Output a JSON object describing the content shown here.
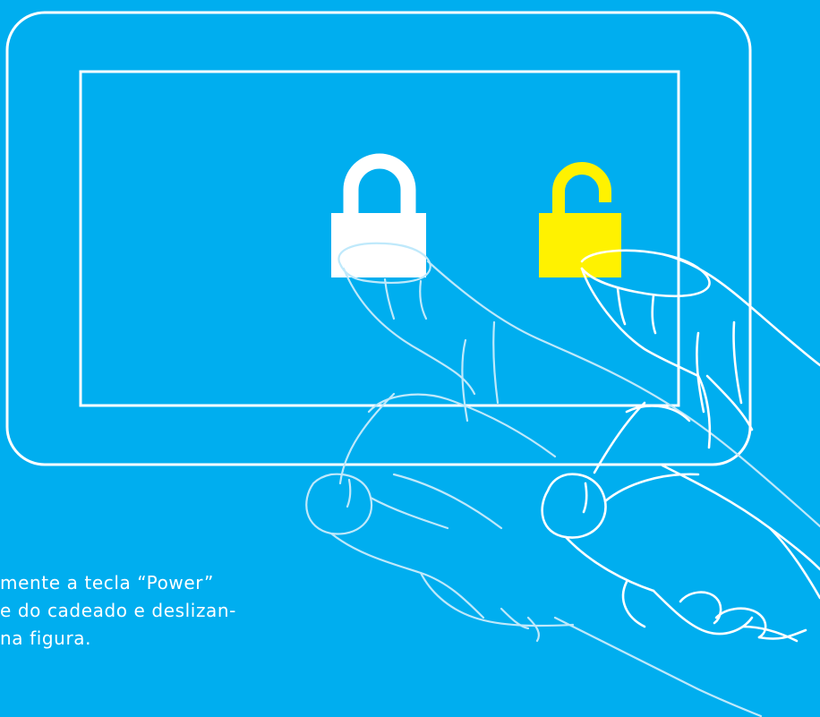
{
  "colors": {
    "background": "#00aeef",
    "outline": "#ffffff",
    "locked_icon": "#ffffff",
    "unlocked_icon": "#fff200",
    "back_hand_stroke": "#bfe9fb",
    "front_hand_stroke": "#ffffff"
  },
  "icons": {
    "locked": "padlock-closed-icon",
    "unlocked": "padlock-open-icon"
  },
  "caption": {
    "line1": "mente a tecla “Power”",
    "line2": "e do cadeado e deslizan-",
    "line3": "na figura."
  }
}
